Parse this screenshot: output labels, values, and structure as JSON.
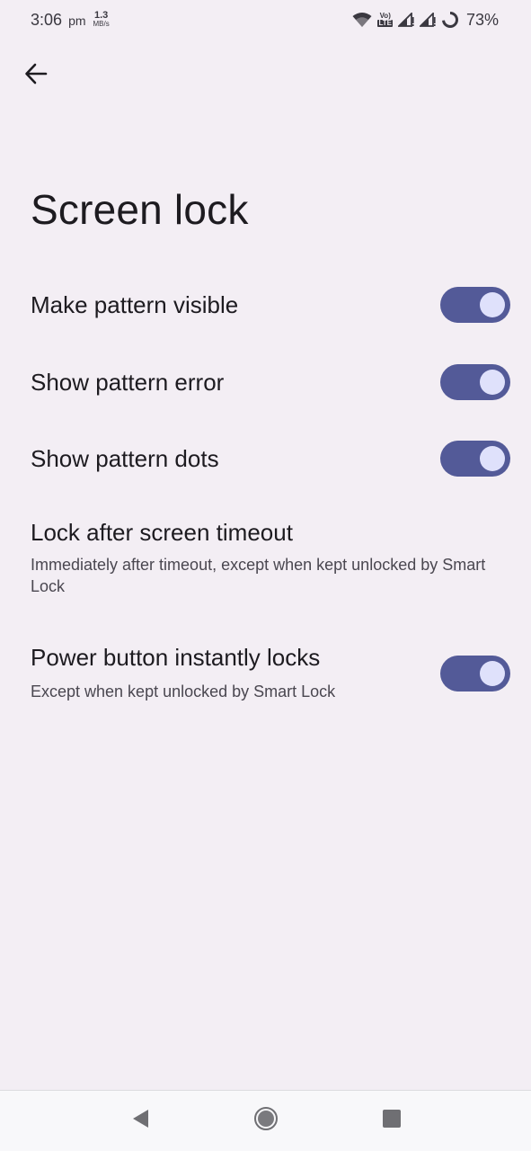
{
  "status_bar": {
    "time": "3:06",
    "ampm": "pm",
    "net_speed_value": "1.3",
    "net_speed_unit": "MB/s",
    "volte_top": "Vo)",
    "volte_bottom": "LTE",
    "battery": "73%",
    "icons": [
      "wifi-icon",
      "volte-icon",
      "signal-icon",
      "signal-icon",
      "battery-ring-icon"
    ]
  },
  "header": {
    "back_icon": "arrow-back-icon",
    "title": "Screen lock"
  },
  "settings": [
    {
      "title": "Make pattern visible",
      "summary": "",
      "toggle": true,
      "on": true
    },
    {
      "title": "Show pattern error",
      "summary": "",
      "toggle": true,
      "on": true
    },
    {
      "title": "Show pattern dots",
      "summary": "",
      "toggle": true,
      "on": true
    },
    {
      "title": "Lock after screen timeout",
      "summary": "Immediately after timeout, except when kept unlocked by Smart Lock",
      "toggle": false
    },
    {
      "title": "Power button instantly locks",
      "summary": "Except when kept unlocked by Smart Lock",
      "toggle": true,
      "on": true
    }
  ],
  "nav_bar": {
    "icons": [
      "back-triangle-icon",
      "home-circle-icon",
      "recents-square-icon"
    ]
  },
  "colors": {
    "background": "#f3eef4",
    "switch_track_on": "#535a98",
    "switch_thumb_on": "#dfe1fb"
  }
}
